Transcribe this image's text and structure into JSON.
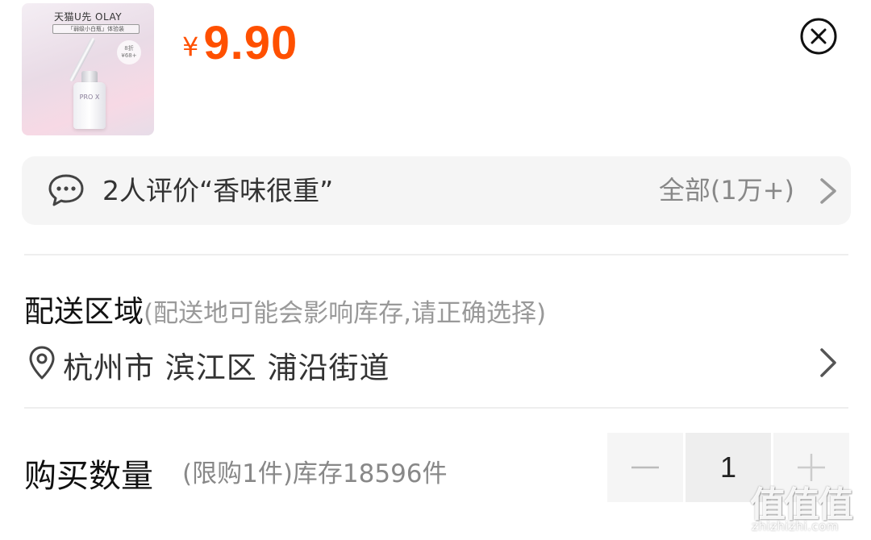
{
  "product": {
    "thumbnail": {
      "brand": "天猫U先  OLAY",
      "tag": "「弱级小白瓶」体验装",
      "badge": "8折 ¥68+",
      "bottle_label": "PRO X"
    },
    "price": {
      "currency": "¥",
      "value": "9.90"
    },
    "close_icon": "close-circle-icon"
  },
  "review": {
    "icon": "chat-bubble-icon",
    "summary": "2人评价“香味很重”",
    "all_label": "全部(1万+)",
    "chevron_icon": "chevron-right-icon"
  },
  "delivery": {
    "title": "配送区域",
    "hint": "(配送地可能会影响库存,请正确选择)",
    "location_icon": "location-pin-icon",
    "location": "杭州市 滨江区 浦沿街道",
    "chevron_icon": "chevron-right-icon"
  },
  "quantity": {
    "title": "购买数量",
    "hint": "(限购1件)库存18596件",
    "value": "1",
    "decrement_icon": "minus-icon",
    "increment_icon": "plus-icon"
  },
  "watermark": {
    "logo": "值值值",
    "url": "zhizhizhi.com"
  },
  "colors": {
    "price": "#ff5000",
    "panel_bg": "#f5f5f5",
    "divider": "#eeeeee",
    "hint_text": "#999999"
  }
}
